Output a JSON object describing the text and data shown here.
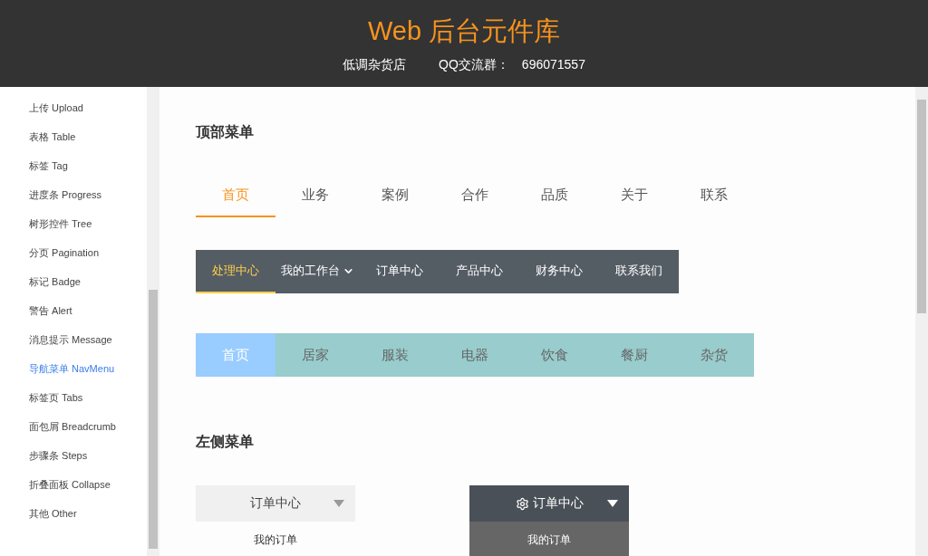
{
  "header": {
    "title": "Web 后台元件库",
    "shop": "低调杂货店",
    "qq_label": "QQ交流群：",
    "qq_number": "696071557"
  },
  "sidebar": {
    "items": [
      {
        "label": "上传 Upload",
        "selected": false
      },
      {
        "label": "表格 Table",
        "selected": false
      },
      {
        "label": "标签 Tag",
        "selected": false
      },
      {
        "label": "进度条 Progress",
        "selected": false
      },
      {
        "label": "树形控件 Tree",
        "selected": false
      },
      {
        "label": "分页 Pagination",
        "selected": false
      },
      {
        "label": "标记 Badge",
        "selected": false
      },
      {
        "label": "警告 Alert",
        "selected": false
      },
      {
        "label": "消息提示 Message",
        "selected": false
      },
      {
        "label": "导航菜单 NavMenu",
        "selected": true
      },
      {
        "label": "标签页 Tabs",
        "selected": false
      },
      {
        "label": "面包屑 Breadcrumb",
        "selected": false
      },
      {
        "label": "步骤条 Steps",
        "selected": false
      },
      {
        "label": "折叠面板 Collapse",
        "selected": false
      },
      {
        "label": "其他 Other",
        "selected": false
      }
    ]
  },
  "top_section": {
    "title": "顶部菜单"
  },
  "menu_plain": [
    {
      "label": "首页",
      "selected": true
    },
    {
      "label": "业务",
      "selected": false
    },
    {
      "label": "案例",
      "selected": false
    },
    {
      "label": "合作",
      "selected": false
    },
    {
      "label": "品质",
      "selected": false
    },
    {
      "label": "关于",
      "selected": false
    },
    {
      "label": "联系",
      "selected": false
    }
  ],
  "menu_dark": [
    {
      "label": "处理中心",
      "selected": true,
      "dropdown": false
    },
    {
      "label": "我的工作台",
      "selected": false,
      "dropdown": true
    },
    {
      "label": "订单中心",
      "selected": false,
      "dropdown": false
    },
    {
      "label": "产品中心",
      "selected": false,
      "dropdown": false
    },
    {
      "label": "财务中心",
      "selected": false,
      "dropdown": false
    },
    {
      "label": "联系我们",
      "selected": false,
      "dropdown": false
    }
  ],
  "menu_teal": [
    {
      "label": "首页",
      "selected": true
    },
    {
      "label": "居家",
      "selected": false
    },
    {
      "label": "服装",
      "selected": false
    },
    {
      "label": "电器",
      "selected": false
    },
    {
      "label": "饮食",
      "selected": false
    },
    {
      "label": "餐厨",
      "selected": false
    },
    {
      "label": "杂货",
      "selected": false
    }
  ],
  "side_section": {
    "title": "左侧菜单"
  },
  "side_menus": [
    {
      "kind": "light",
      "title": "订单中心",
      "expanded": true,
      "items": [
        "我的订单"
      ]
    },
    {
      "kind": "dark",
      "title": "订单中心",
      "expanded": true,
      "items": [
        "我的订单"
      ]
    }
  ]
}
